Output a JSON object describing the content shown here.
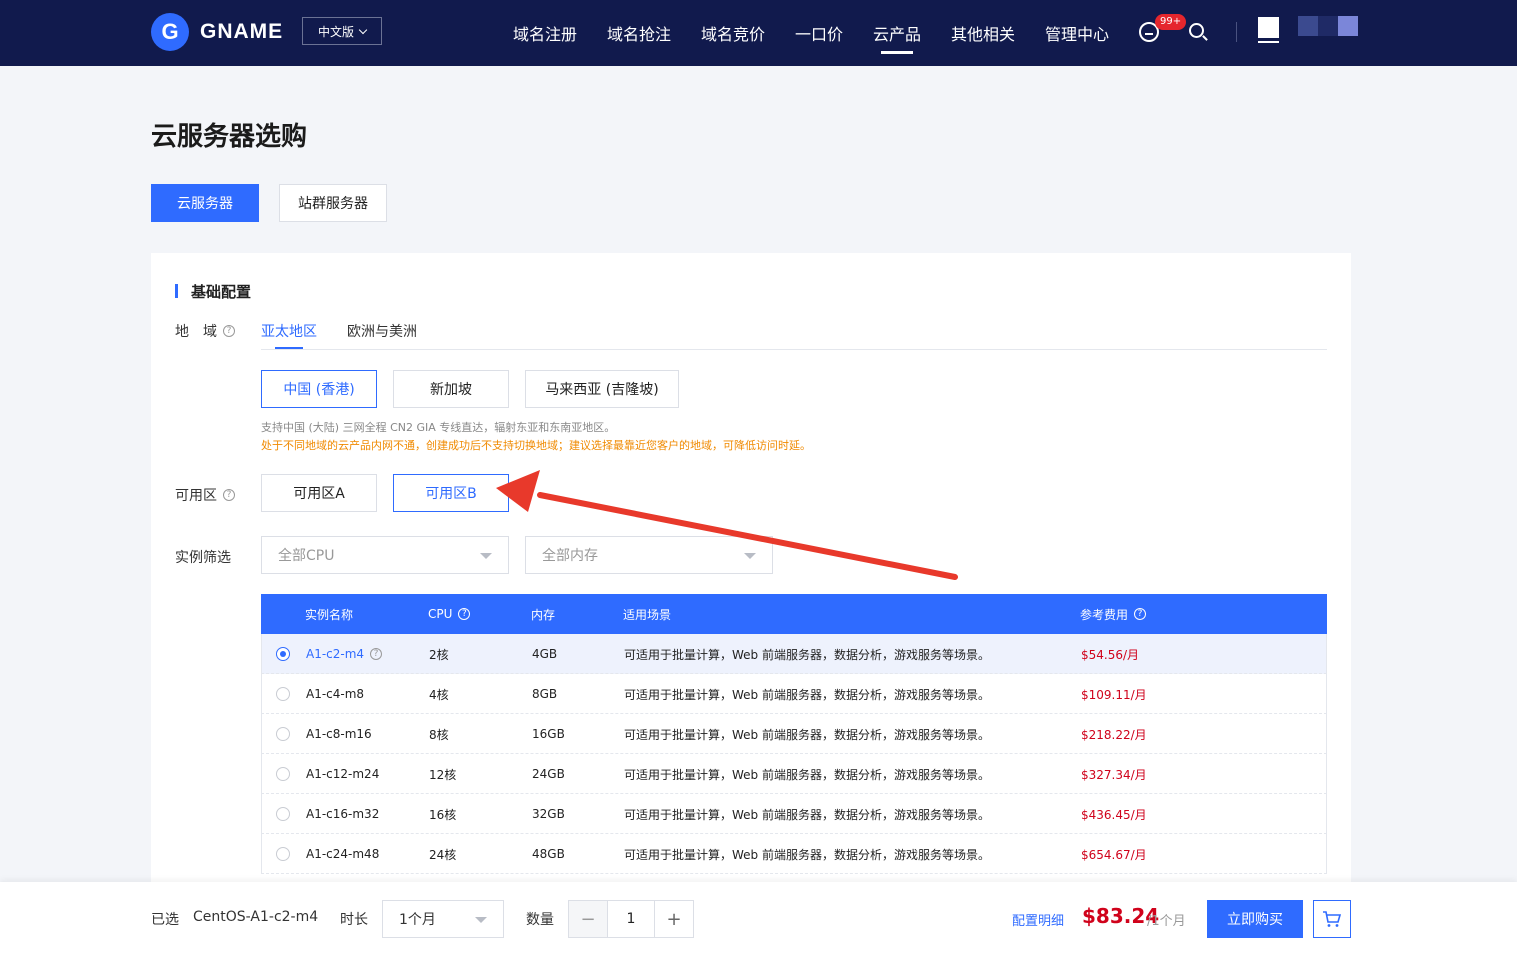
{
  "nav": {
    "logo_letter": "G",
    "brand": "GNAME",
    "lang": "中文版",
    "items": [
      "域名注册",
      "域名抢注",
      "域名竞价",
      "一口价",
      "云产品",
      "其他相关",
      "管理中心"
    ],
    "active_item": "云产品",
    "cart_badge": "99+",
    "avatar_colors": [
      "#3b4a8f",
      "#1f2a66",
      "#7b86d9"
    ]
  },
  "page": {
    "title": "云服务器选购",
    "tabs": [
      "云服务器",
      "站群服务器"
    ]
  },
  "basic": {
    "section_title": "基础配置",
    "region_label": "地　域",
    "region_tabs": [
      "亚太地区",
      "欧洲与美洲"
    ],
    "locations": [
      "中国 (香港)",
      "新加坡",
      "马来西亚 (吉隆坡)"
    ],
    "selected_location": "中国 (香港)",
    "note_info": "支持中国 (大陆) 三网全程 CN2 GIA 专线直达，辐射东亚和东南亚地区。",
    "note_warning": "处于不同地域的云产品内网不通，创建成功后不支持切换地域；建议选择最靠近您客户的地域，可降低访问时延。",
    "zone_label": "可用区",
    "zones": [
      "可用区A",
      "可用区B"
    ],
    "selected_zone": "可用区B",
    "filter_label": "实例筛选",
    "cpu_placeholder": "全部CPU",
    "mem_placeholder": "全部内存"
  },
  "table": {
    "headers": [
      "实例名称",
      "CPU",
      "内存",
      "适用场景",
      "参考费用"
    ],
    "rows": [
      {
        "name": "A1-c2-m4",
        "cpu": "2核",
        "mem": "4GB",
        "scene": "可适用于批量计算，Web 前端服务器，数据分析，游戏服务等场景。",
        "price": "$54.56/月"
      },
      {
        "name": "A1-c4-m8",
        "cpu": "4核",
        "mem": "8GB",
        "scene": "可适用于批量计算，Web 前端服务器，数据分析，游戏服务等场景。",
        "price": "$109.11/月"
      },
      {
        "name": "A1-c8-m16",
        "cpu": "8核",
        "mem": "16GB",
        "scene": "可适用于批量计算，Web 前端服务器，数据分析，游戏服务等场景。",
        "price": "$218.22/月"
      },
      {
        "name": "A1-c12-m24",
        "cpu": "12核",
        "mem": "24GB",
        "scene": "可适用于批量计算，Web 前端服务器，数据分析，游戏服务等场景。",
        "price": "$327.34/月"
      },
      {
        "name": "A1-c16-m32",
        "cpu": "16核",
        "mem": "32GB",
        "scene": "可适用于批量计算，Web 前端服务器，数据分析，游戏服务等场景。",
        "price": "$436.45/月"
      },
      {
        "name": "A1-c24-m48",
        "cpu": "24核",
        "mem": "48GB",
        "scene": "可适用于批量计算，Web 前端服务器，数据分析，游戏服务等场景。",
        "price": "$654.67/月"
      }
    ]
  },
  "bottom": {
    "selected_label": "已选",
    "selected_value": "CentOS-A1-c2-m4",
    "duration_label": "时长",
    "duration_value": "1个月",
    "qty_label": "数量",
    "qty_minus": "−",
    "qty_value": "1",
    "qty_plus": "+",
    "detail_link": "配置明细",
    "total": "$83.24",
    "per": "/1个月",
    "buy": "立即购买"
  },
  "colors": {
    "accent": "#2f6bff",
    "nav_bg": "#111a4d",
    "price": "#d0021b",
    "warning": "#f08a00",
    "annotation_arrow": "#e8392b"
  }
}
